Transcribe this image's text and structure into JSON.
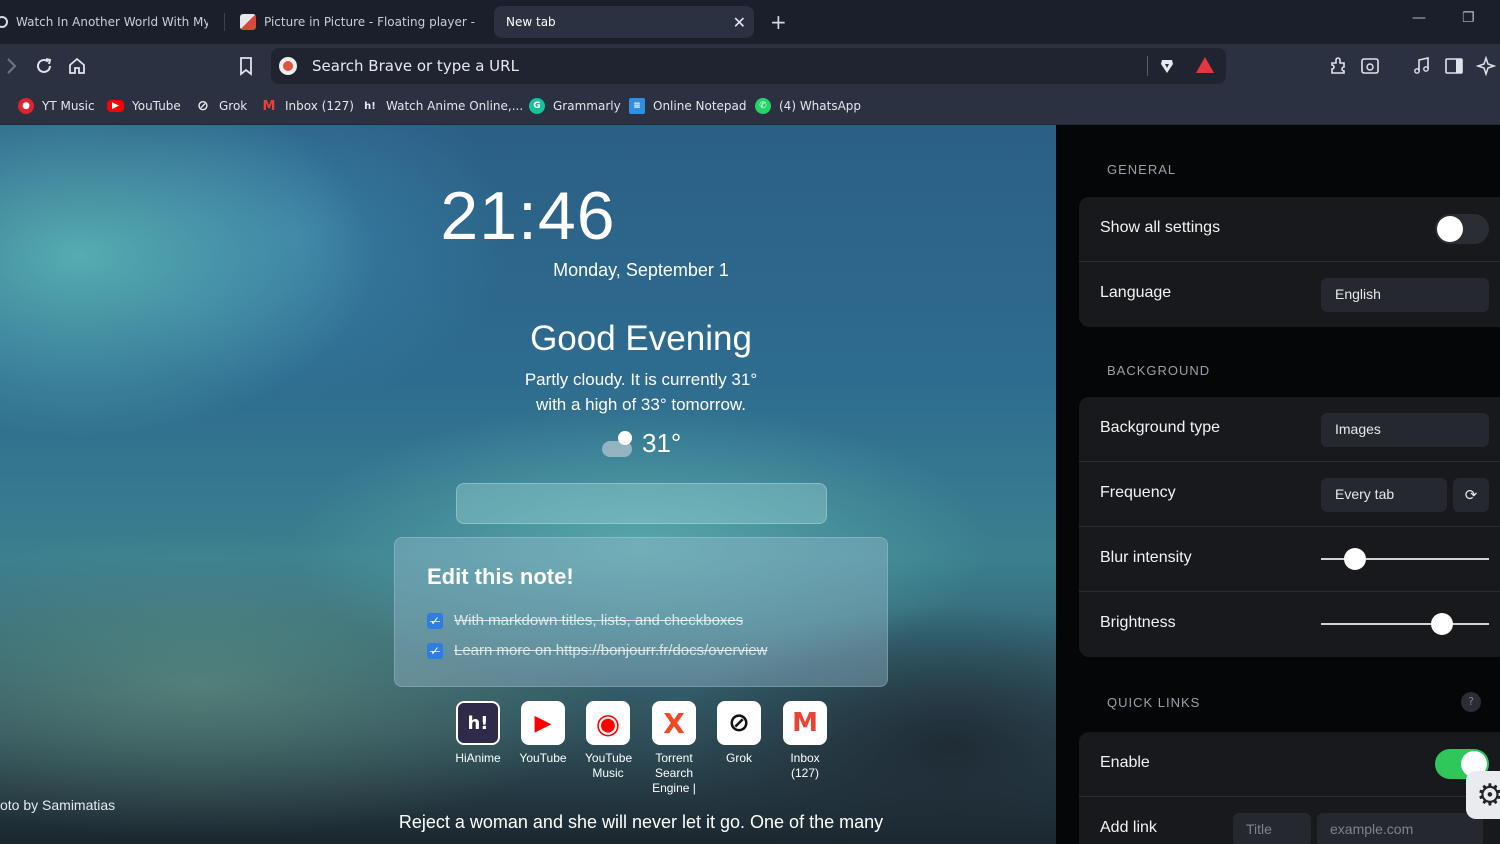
{
  "tabs": [
    {
      "title": "Watch In Another World With My Sm",
      "active": false
    },
    {
      "title": "Picture in Picture - Floating player - Chro",
      "active": false
    },
    {
      "title": "New tab",
      "active": true
    }
  ],
  "tab_close_glyph": "✕",
  "new_tab_glyph": "+",
  "window_controls": {
    "minimize": "—",
    "maximize": "❐"
  },
  "urlbar": {
    "placeholder": "Search Brave or type a URL"
  },
  "bookmarks": [
    {
      "label": "YT Music",
      "icon": "yt-music-icon",
      "color": "#e0222b"
    },
    {
      "label": "YouTube",
      "icon": "youtube-icon",
      "color": "#ff0000"
    },
    {
      "label": "Grok",
      "icon": "grok-icon",
      "color": "#ffffff"
    },
    {
      "label": "Inbox (127)",
      "icon": "gmail-icon",
      "color": "#ea4335"
    },
    {
      "label": "Watch Anime Online,...",
      "icon": "hianime-icon",
      "color": "#2b3140"
    },
    {
      "label": "Grammarly",
      "icon": "grammarly-icon",
      "color": "#15c39a"
    },
    {
      "label": "Online Notepad",
      "icon": "notepad-icon",
      "color": "#2f8fe0"
    },
    {
      "label": "(4) WhatsApp",
      "icon": "whatsapp-icon",
      "color": "#25d366"
    }
  ],
  "ntp": {
    "clock": "21:46",
    "date": "Monday, September 1",
    "greeting": "Good Evening",
    "weather_line1": "Partly cloudy. It is currently 31°",
    "weather_line2": "with a high of 33° tomorrow.",
    "temperature": "31°",
    "note": {
      "title": "Edit this note!",
      "items": [
        "With markdown titles, lists, and checkboxes",
        "Learn more on https://bonjourr.fr/docs/overview"
      ]
    },
    "quick_links": [
      {
        "label": "HiAnime",
        "glyph": "h!",
        "icon": "hianime-icon",
        "bg": "#2f2a4a",
        "fg": "#ffffff"
      },
      {
        "label": "YouTube",
        "glyph": "▶",
        "icon": "youtube-icon",
        "bg": "#ffffff",
        "fg": "#ff0000"
      },
      {
        "label": "YouTube Music",
        "glyph": "◉",
        "icon": "yt-music-icon",
        "bg": "#ffffff",
        "fg": "#ff0000"
      },
      {
        "label": "Torrent Search Engine |",
        "glyph": "X",
        "icon": "torrent-icon",
        "bg": "#ffffff",
        "fg": "#f04a24"
      },
      {
        "label": "Grok",
        "glyph": "⊘",
        "icon": "grok-icon",
        "bg": "#ffffff",
        "fg": "#111111"
      },
      {
        "label": "Inbox (127)",
        "glyph": "M",
        "icon": "gmail-icon",
        "bg": "#ffffff",
        "fg": "#ea4335"
      }
    ],
    "photo_credit": "oto by Samimatias",
    "quote": "Reject a woman and she will never let it go. One of the many"
  },
  "settings": {
    "general": {
      "title": "GENERAL",
      "show_all_label": "Show all settings",
      "show_all_on": false,
      "language_label": "Language",
      "language_value": "English"
    },
    "background": {
      "title": "BACKGROUND",
      "type_label": "Background type",
      "type_value": "Images",
      "frequency_label": "Frequency",
      "frequency_value": "Every tab",
      "blur_label": "Blur intensity",
      "blur_level": 0.2,
      "brightness_label": "Brightness",
      "brightness_level": 0.72
    },
    "quick_links": {
      "title": "QUICK LINKS",
      "help": "?",
      "enable_label": "Enable",
      "enable_on": true,
      "add_link_label": "Add link",
      "title_placeholder": "Title",
      "url_placeholder": "example.com"
    }
  }
}
